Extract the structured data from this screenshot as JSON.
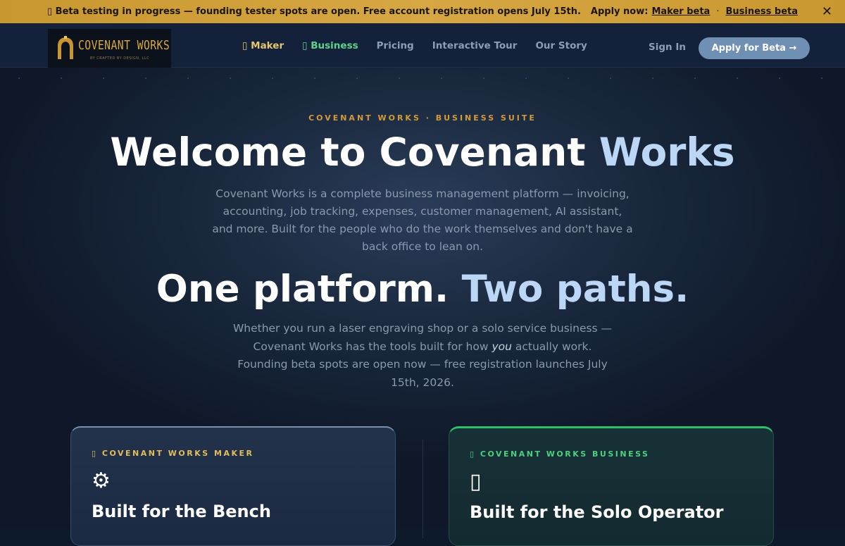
{
  "beta_bar": {
    "message": "▯ Beta testing in progress — founding tester spots are open. Free account registration opens July 15th.",
    "apply_prefix": "Apply now:",
    "maker_link": "Maker beta",
    "separator": "·",
    "business_link": "Business beta",
    "close_icon": "✕"
  },
  "nav": {
    "logo_text": "COVENANT WORKS",
    "logo_sub": "BY CRAFTED BY DESIGN, LLC",
    "links": [
      "▯ Maker",
      "▯ Business",
      "Pricing",
      "Interactive Tour",
      "Our Story"
    ],
    "sign_in": "Sign In",
    "apply_button": "Apply for Beta →"
  },
  "hero": {
    "eyebrow": "COVENANT WORKS · BUSINESS SUITE",
    "title_main": "Welcome to Covenant",
    "title_accent": "Works",
    "lead": "Covenant Works is a complete business management platform — invoicing, accounting, job tracking, expenses, customer management, AI assistant, and more. Built for the people who do the work themselves and don't have a back office to lean on.",
    "h2_main": "One platform.",
    "h2_accent": "Two paths.",
    "sub_lead_1": "Whether you run a laser engraving shop or a solo service business — Covenant Works has the tools built for how",
    "sub_lead_em": "you",
    "sub_lead_2": "actually work. Founding beta spots are open now — free registration launches July 15th, 2026."
  },
  "cards": {
    "maker": {
      "tag": "▯ COVENANT WORKS MAKER",
      "icon": "⚙",
      "title": "Built for the Bench"
    },
    "business": {
      "tag": "▯ COVENANT WORKS BUSINESS",
      "icon": "▯",
      "title": "Built for the Solo Operator"
    }
  },
  "colors": {
    "beta_bar": "#d6a744",
    "nav_bg": "#14213a",
    "maker_accent": "#e3bd5c",
    "business_accent": "#2fbf68",
    "cta": "#6f8fb3"
  }
}
